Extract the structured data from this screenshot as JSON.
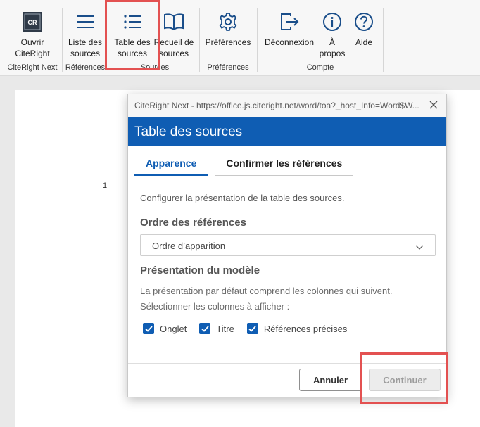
{
  "ribbon": {
    "buttons": [
      {
        "line1": "Ouvrir",
        "line2": "CiteRight",
        "icon": "citeright-logo-icon"
      },
      {
        "line1": "Liste des",
        "line2": "sources",
        "icon": "list-lines-icon"
      },
      {
        "line1": "Table des",
        "line2": "sources",
        "icon": "bulleted-list-icon"
      },
      {
        "line1": "Recueil de",
        "line2": "sources",
        "icon": "book-icon"
      },
      {
        "line1": "Préférences",
        "line2": "",
        "icon": "gear-icon"
      },
      {
        "line1": "Déconnexion",
        "line2": "",
        "icon": "sign-out-icon"
      },
      {
        "line1": "À",
        "line2": "propos",
        "icon": "info-icon"
      },
      {
        "line1": "Aide",
        "line2": "",
        "icon": "help-icon"
      }
    ],
    "groups": [
      "CiteRight Next",
      "Références",
      "Sources",
      "Préférences",
      "Compte"
    ],
    "logo_text": "CR"
  },
  "document": {
    "page_number": "1"
  },
  "dialog": {
    "window_title": "CiteRight Next - https://office.js.citeright.net/word/toa?_host_Info=Word$W...",
    "header": "Table des sources",
    "tabs": [
      "Apparence",
      "Confirmer les références"
    ],
    "intro": "Configurer la présentation de la table des sources.",
    "order_heading": "Ordre des références",
    "order_value": "Ordre d’apparition",
    "model_heading": "Présentation du modèle",
    "desc_line1": "La présentation par défaut comprend les colonnes qui suivent.",
    "desc_line2": "Sélectionner les colonnes à afficher :",
    "checkboxes": [
      {
        "label": "Onglet",
        "checked": true
      },
      {
        "label": "Titre",
        "checked": true
      },
      {
        "label": "Références précises",
        "checked": true
      }
    ],
    "cancel_label": "Annuler",
    "continue_label": "Continuer"
  },
  "colors": {
    "accent": "#0f5db3",
    "highlight": "#e35151"
  }
}
